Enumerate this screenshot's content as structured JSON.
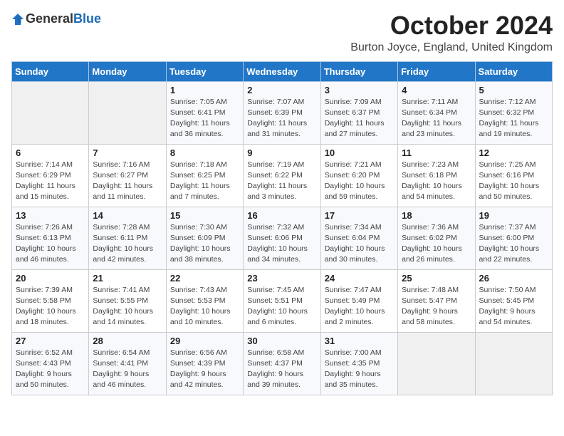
{
  "header": {
    "logo_general": "General",
    "logo_blue": "Blue",
    "month_title": "October 2024",
    "location": "Burton Joyce, England, United Kingdom"
  },
  "days_of_week": [
    "Sunday",
    "Monday",
    "Tuesday",
    "Wednesday",
    "Thursday",
    "Friday",
    "Saturday"
  ],
  "weeks": [
    [
      {
        "day": "",
        "info": ""
      },
      {
        "day": "",
        "info": ""
      },
      {
        "day": "1",
        "info": "Sunrise: 7:05 AM\nSunset: 6:41 PM\nDaylight: 11 hours and 36 minutes."
      },
      {
        "day": "2",
        "info": "Sunrise: 7:07 AM\nSunset: 6:39 PM\nDaylight: 11 hours and 31 minutes."
      },
      {
        "day": "3",
        "info": "Sunrise: 7:09 AM\nSunset: 6:37 PM\nDaylight: 11 hours and 27 minutes."
      },
      {
        "day": "4",
        "info": "Sunrise: 7:11 AM\nSunset: 6:34 PM\nDaylight: 11 hours and 23 minutes."
      },
      {
        "day": "5",
        "info": "Sunrise: 7:12 AM\nSunset: 6:32 PM\nDaylight: 11 hours and 19 minutes."
      }
    ],
    [
      {
        "day": "6",
        "info": "Sunrise: 7:14 AM\nSunset: 6:29 PM\nDaylight: 11 hours and 15 minutes."
      },
      {
        "day": "7",
        "info": "Sunrise: 7:16 AM\nSunset: 6:27 PM\nDaylight: 11 hours and 11 minutes."
      },
      {
        "day": "8",
        "info": "Sunrise: 7:18 AM\nSunset: 6:25 PM\nDaylight: 11 hours and 7 minutes."
      },
      {
        "day": "9",
        "info": "Sunrise: 7:19 AM\nSunset: 6:22 PM\nDaylight: 11 hours and 3 minutes."
      },
      {
        "day": "10",
        "info": "Sunrise: 7:21 AM\nSunset: 6:20 PM\nDaylight: 10 hours and 59 minutes."
      },
      {
        "day": "11",
        "info": "Sunrise: 7:23 AM\nSunset: 6:18 PM\nDaylight: 10 hours and 54 minutes."
      },
      {
        "day": "12",
        "info": "Sunrise: 7:25 AM\nSunset: 6:16 PM\nDaylight: 10 hours and 50 minutes."
      }
    ],
    [
      {
        "day": "13",
        "info": "Sunrise: 7:26 AM\nSunset: 6:13 PM\nDaylight: 10 hours and 46 minutes."
      },
      {
        "day": "14",
        "info": "Sunrise: 7:28 AM\nSunset: 6:11 PM\nDaylight: 10 hours and 42 minutes."
      },
      {
        "day": "15",
        "info": "Sunrise: 7:30 AM\nSunset: 6:09 PM\nDaylight: 10 hours and 38 minutes."
      },
      {
        "day": "16",
        "info": "Sunrise: 7:32 AM\nSunset: 6:06 PM\nDaylight: 10 hours and 34 minutes."
      },
      {
        "day": "17",
        "info": "Sunrise: 7:34 AM\nSunset: 6:04 PM\nDaylight: 10 hours and 30 minutes."
      },
      {
        "day": "18",
        "info": "Sunrise: 7:36 AM\nSunset: 6:02 PM\nDaylight: 10 hours and 26 minutes."
      },
      {
        "day": "19",
        "info": "Sunrise: 7:37 AM\nSunset: 6:00 PM\nDaylight: 10 hours and 22 minutes."
      }
    ],
    [
      {
        "day": "20",
        "info": "Sunrise: 7:39 AM\nSunset: 5:58 PM\nDaylight: 10 hours and 18 minutes."
      },
      {
        "day": "21",
        "info": "Sunrise: 7:41 AM\nSunset: 5:55 PM\nDaylight: 10 hours and 14 minutes."
      },
      {
        "day": "22",
        "info": "Sunrise: 7:43 AM\nSunset: 5:53 PM\nDaylight: 10 hours and 10 minutes."
      },
      {
        "day": "23",
        "info": "Sunrise: 7:45 AM\nSunset: 5:51 PM\nDaylight: 10 hours and 6 minutes."
      },
      {
        "day": "24",
        "info": "Sunrise: 7:47 AM\nSunset: 5:49 PM\nDaylight: 10 hours and 2 minutes."
      },
      {
        "day": "25",
        "info": "Sunrise: 7:48 AM\nSunset: 5:47 PM\nDaylight: 9 hours and 58 minutes."
      },
      {
        "day": "26",
        "info": "Sunrise: 7:50 AM\nSunset: 5:45 PM\nDaylight: 9 hours and 54 minutes."
      }
    ],
    [
      {
        "day": "27",
        "info": "Sunrise: 6:52 AM\nSunset: 4:43 PM\nDaylight: 9 hours and 50 minutes."
      },
      {
        "day": "28",
        "info": "Sunrise: 6:54 AM\nSunset: 4:41 PM\nDaylight: 9 hours and 46 minutes."
      },
      {
        "day": "29",
        "info": "Sunrise: 6:56 AM\nSunset: 4:39 PM\nDaylight: 9 hours and 42 minutes."
      },
      {
        "day": "30",
        "info": "Sunrise: 6:58 AM\nSunset: 4:37 PM\nDaylight: 9 hours and 39 minutes."
      },
      {
        "day": "31",
        "info": "Sunrise: 7:00 AM\nSunset: 4:35 PM\nDaylight: 9 hours and 35 minutes."
      },
      {
        "day": "",
        "info": ""
      },
      {
        "day": "",
        "info": ""
      }
    ]
  ]
}
